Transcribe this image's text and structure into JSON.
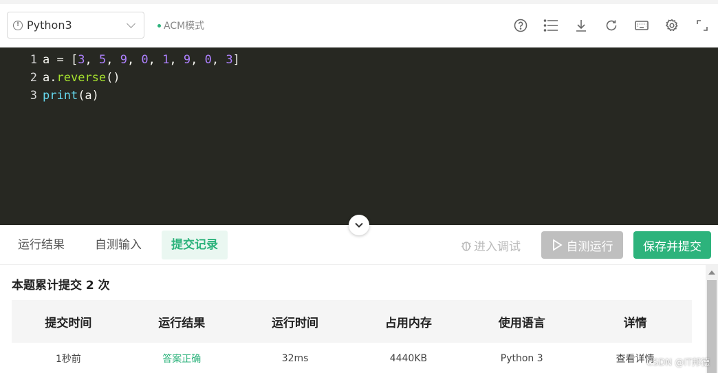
{
  "toolbar": {
    "language": "Python3",
    "mode": "ACM模式",
    "icons": [
      "help-icon",
      "list-icon",
      "download-icon",
      "refresh-icon",
      "keyboard-icon",
      "gear-icon",
      "fullscreen-icon"
    ]
  },
  "editor": {
    "lines": [
      {
        "num": "1"
      },
      {
        "num": "2"
      },
      {
        "num": "3"
      }
    ],
    "line1": {
      "var": "a",
      "eq": " = ",
      "open": "[",
      "n1": "3",
      "n2": "5",
      "n3": "9",
      "n4": "0",
      "n5": "1",
      "n6": "9",
      "n7": "0",
      "n8": "3",
      "close": "]",
      "comma": ", "
    },
    "line2": {
      "obj": "a",
      "dot": ".",
      "method": "reverse",
      "parens": "()"
    },
    "line3": {
      "fn": "print",
      "arg": "(a)"
    }
  },
  "tabs": {
    "result": "运行结果",
    "self_input": "自测输入",
    "records": "提交记录"
  },
  "actions": {
    "debug": "进入调试",
    "run": "自测运行",
    "submit": "保存并提交"
  },
  "summary": "本题累计提交 2 次",
  "table": {
    "headers": [
      "提交时间",
      "运行结果",
      "运行时间",
      "占用内存",
      "使用语言",
      "详情"
    ],
    "rows": [
      [
        "1秒前",
        "答案正确",
        "32ms",
        "4440KB",
        "Python 3",
        "查看详情"
      ]
    ]
  },
  "watermark": "CSDN @IT邦德",
  "colors": {
    "accent": "#2db37c",
    "editor_bg": "#272822",
    "run_disabled": "#bfbfbf"
  }
}
